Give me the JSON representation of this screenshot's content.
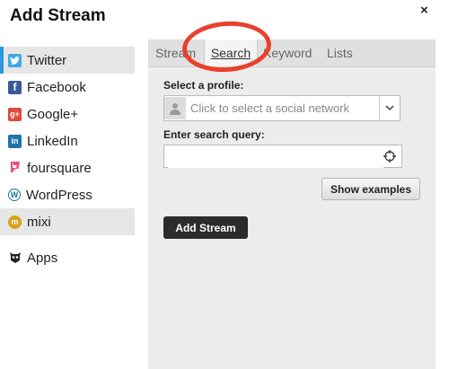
{
  "dialog": {
    "title": "Add Stream",
    "close_symbol": "×"
  },
  "sidebar": {
    "items": [
      {
        "label": "Twitter",
        "icon": "twitter-icon"
      },
      {
        "label": "Facebook",
        "icon": "facebook-icon"
      },
      {
        "label": "Google+",
        "icon": "google-plus-icon"
      },
      {
        "label": "LinkedIn",
        "icon": "linkedin-icon"
      },
      {
        "label": "foursquare",
        "icon": "foursquare-icon"
      },
      {
        "label": "WordPress",
        "icon": "wordpress-icon"
      },
      {
        "label": "mixi",
        "icon": "mixi-icon"
      },
      {
        "label": "Apps",
        "icon": "owl-apps-icon"
      }
    ],
    "active": "Twitter"
  },
  "tabs": [
    {
      "label": "Stream"
    },
    {
      "label": "Search"
    },
    {
      "label": "Keyword"
    },
    {
      "label": "Lists"
    }
  ],
  "active_tab": "Search",
  "form": {
    "profile_label": "Select a profile:",
    "profile_placeholder": "Click to select a social network",
    "query_label": "Enter search query:",
    "query_value": "",
    "show_examples": "Show examples",
    "add_stream": "Add Stream"
  },
  "colors": {
    "accent_bar": "#2b97df",
    "annotation": "#e8412c",
    "primary_button": "#2c2c2c"
  }
}
